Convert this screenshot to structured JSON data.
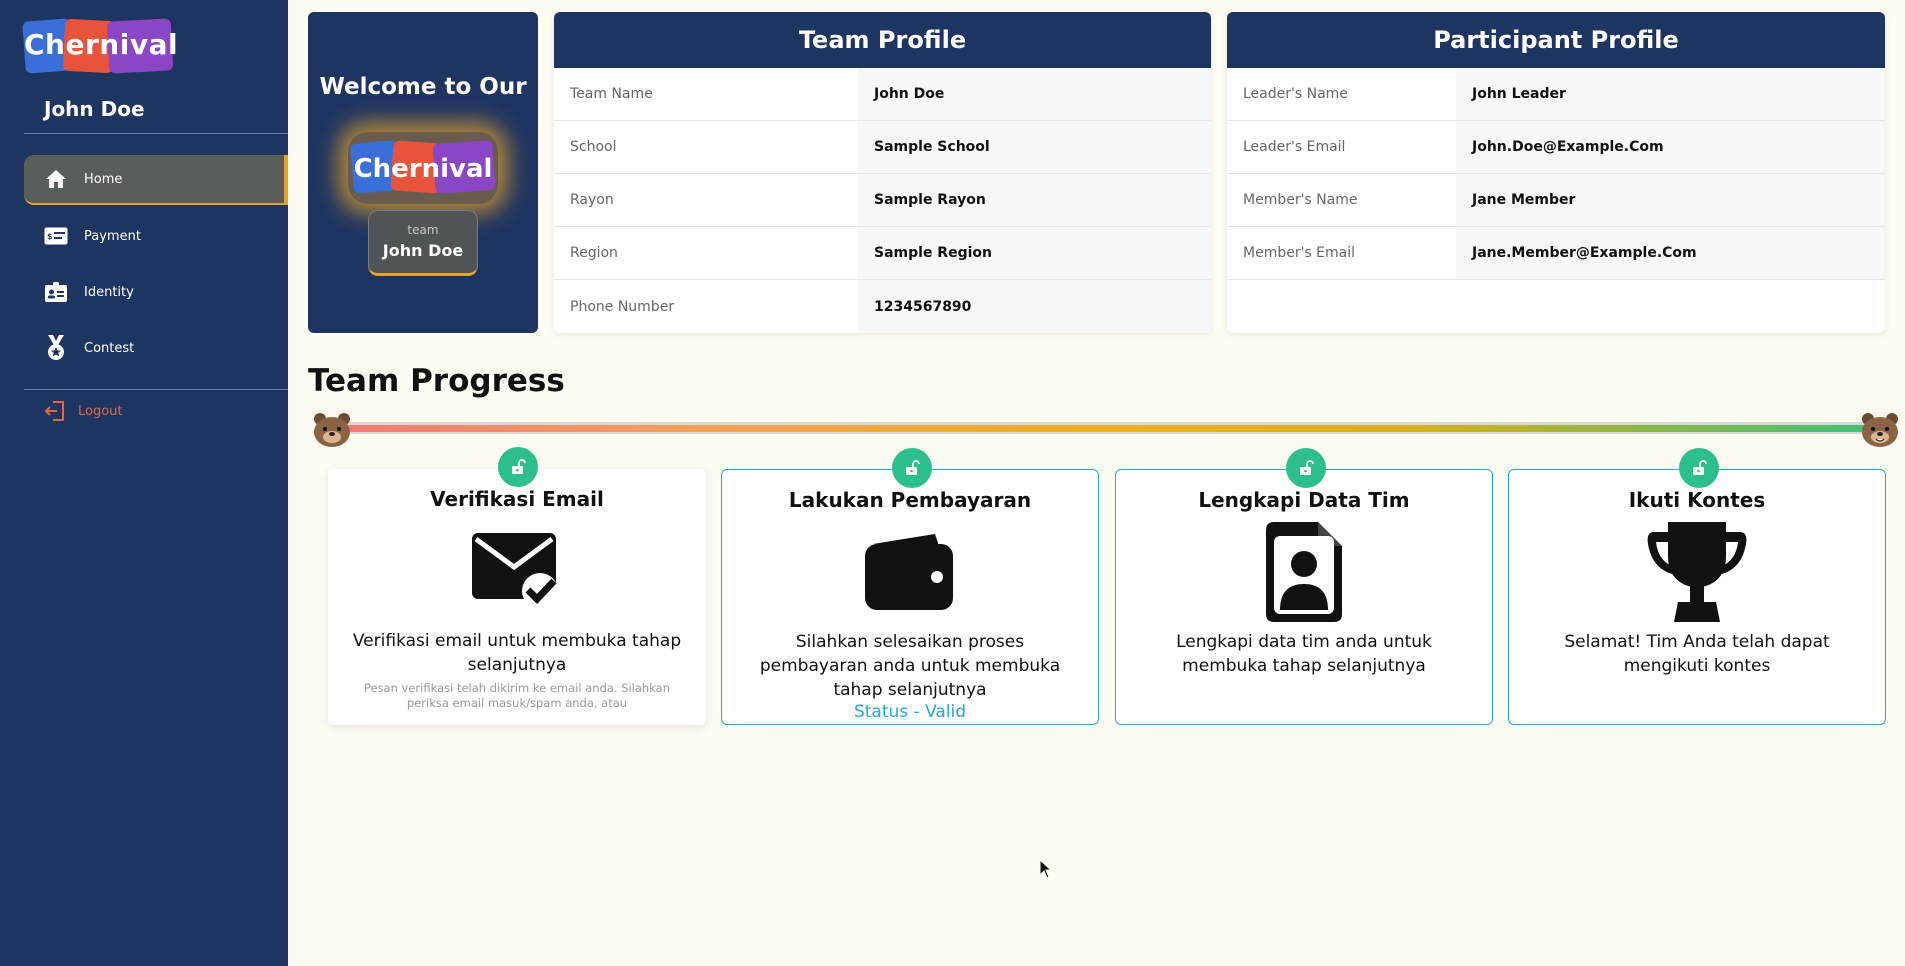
{
  "brand": {
    "logo_text": "Chernival"
  },
  "sidebar": {
    "username": "John Doe",
    "items": [
      {
        "label": "Home",
        "icon": "home-icon",
        "active": true
      },
      {
        "label": "Payment",
        "icon": "payment-card-icon",
        "active": false
      },
      {
        "label": "Identity",
        "icon": "id-card-icon",
        "active": false
      },
      {
        "label": "Contest",
        "icon": "medal-icon",
        "active": false
      }
    ],
    "logout_label": "Logout"
  },
  "welcome": {
    "title": "Welcome to Our",
    "logo_text": "Chernival",
    "team_label": "team",
    "team_name": "John Doe"
  },
  "team_profile": {
    "title": "Team Profile",
    "rows": [
      {
        "key": "Team Name",
        "value": "John Doe"
      },
      {
        "key": "School",
        "value": "Sample School"
      },
      {
        "key": "Rayon",
        "value": "Sample Rayon"
      },
      {
        "key": "Region",
        "value": "Sample Region"
      },
      {
        "key": "Phone Number",
        "value": "1234567890"
      }
    ]
  },
  "participant_profile": {
    "title": "Participant Profile",
    "rows": [
      {
        "key": "Leader's Name",
        "value": "John Leader"
      },
      {
        "key": "Leader's Email",
        "value": "John.Doe@Example.Com"
      },
      {
        "key": "Member's Name",
        "value": "Jane Member"
      },
      {
        "key": "Member's Email",
        "value": "Jane.Member@Example.Com"
      }
    ]
  },
  "progress": {
    "title": "Team Progress",
    "fraction": 1.0,
    "colors": {
      "accent": "#27a6d9",
      "unlocked": "#2dbf8b",
      "sidebar": "#1e3461",
      "highlight": "#e6a42d"
    },
    "steps": [
      {
        "title": "Verifikasi Email",
        "icon": "email-check-icon",
        "description": "Verifikasi email untuk membuka tahap selanjutnya",
        "note": "Pesan verifikasi telah dikirim ke email anda. Silahkan periksa email masuk/spam anda, atau",
        "status": ""
      },
      {
        "title": "Lakukan Pembayaran",
        "icon": "wallet-icon",
        "description": "Silahkan selesaikan proses pembayaran anda untuk membuka tahap selanjutnya",
        "note": "",
        "status": "Status - Valid"
      },
      {
        "title": "Lengkapi Data Tim",
        "icon": "user-document-icon",
        "description": "Lengkapi data tim anda untuk membuka tahap selanjutnya",
        "note": "",
        "status": ""
      },
      {
        "title": "Ikuti Kontes",
        "icon": "trophy-icon",
        "description": "Selamat! Tim Anda telah dapat mengikuti kontes",
        "note": "",
        "status": ""
      }
    ]
  }
}
